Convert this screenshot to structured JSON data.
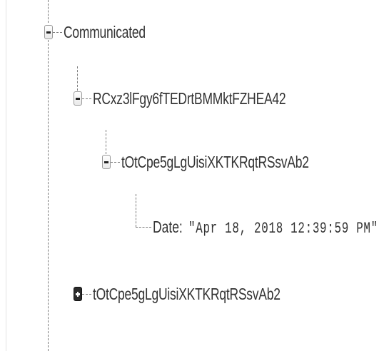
{
  "tree": {
    "root": {
      "label": "Communicated",
      "expanded": true,
      "children": [
        {
          "label": "RCxz3lFgy6fTEDrtBMMktFZHEA42",
          "expanded": true,
          "children": [
            {
              "label": "tOtCpe5gLgUisiXKTKRqtRSsvAb2",
              "expanded": true,
              "leaf": {
                "key": "Date:",
                "value": "\"Apr 18, 2018 12:39:59 PM\""
              }
            }
          ]
        },
        {
          "label": "tOtCpe5gLgUisiXKTKRqtRSsvAb2",
          "expanded": false
        }
      ]
    }
  },
  "icons": {
    "expanded": "minus-toggle-icon",
    "collapsed": "plus-toggle-icon"
  },
  "colors": {
    "text": "#333333",
    "connector": "#7a7a7a",
    "toggle_border": "#9a9a9a",
    "collapsed_toggle": "#2b2b2b"
  }
}
